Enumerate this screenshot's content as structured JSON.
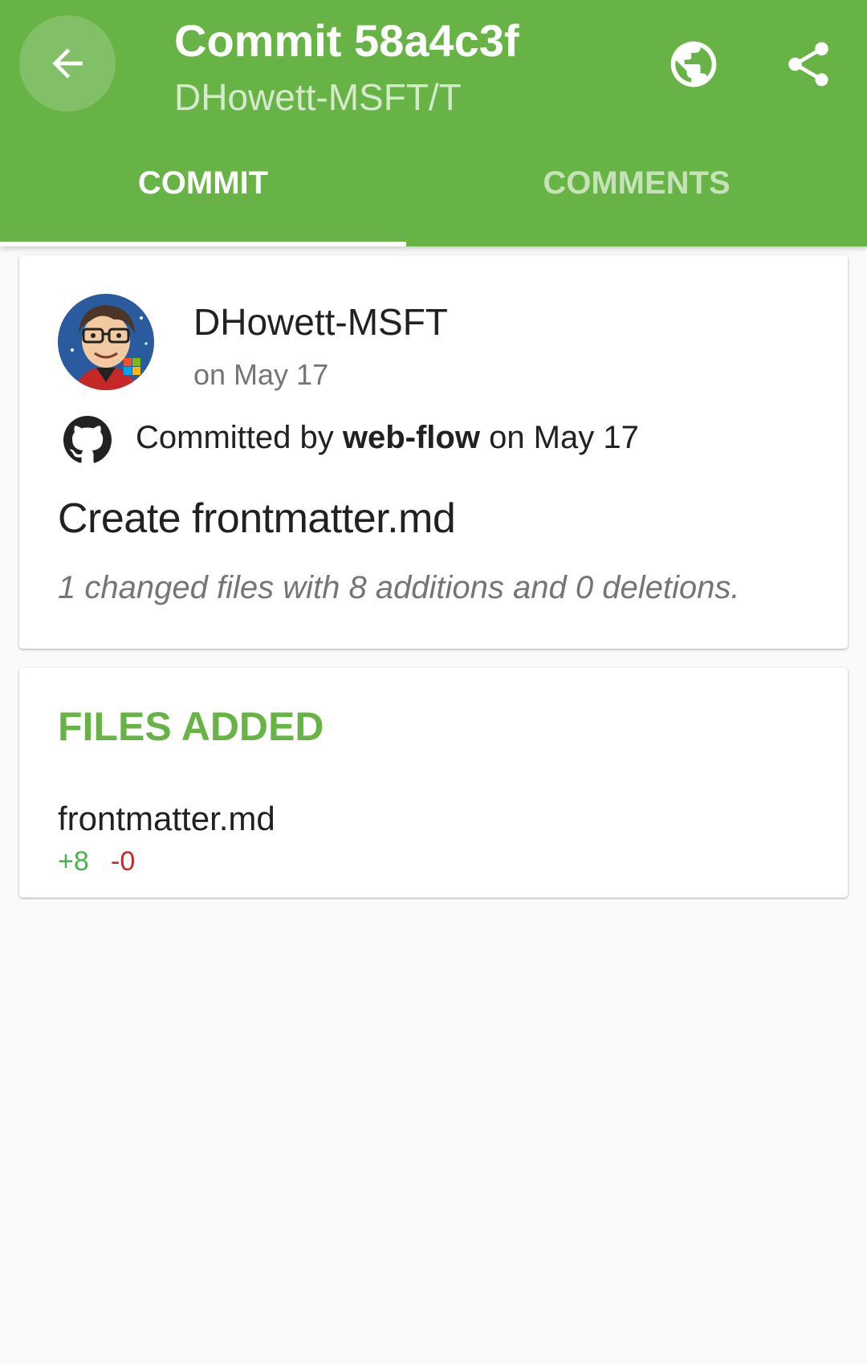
{
  "appbar": {
    "title": "Commit 58a4c3f",
    "subtitle": "DHowett-MSFT/T",
    "back_icon": "arrow-left-icon",
    "browser_icon": "globe-icon",
    "share_icon": "share-icon",
    "color": "#67b346"
  },
  "tabs": [
    {
      "label": "COMMIT",
      "selected": true
    },
    {
      "label": "COMMENTS",
      "selected": false
    }
  ],
  "commit": {
    "author": "DHowett-MSFT",
    "author_date": "on May 17",
    "committed_prefix": "Committed by ",
    "committer": "web-flow",
    "committed_suffix": " on May 17",
    "message": "Create frontmatter.md",
    "stats": "1 changed files with 8 additions and 0 deletions."
  },
  "files": {
    "heading": "FILES ADDED",
    "items": [
      {
        "name": "frontmatter.md",
        "additions": "+8",
        "deletions": "-0"
      }
    ]
  }
}
